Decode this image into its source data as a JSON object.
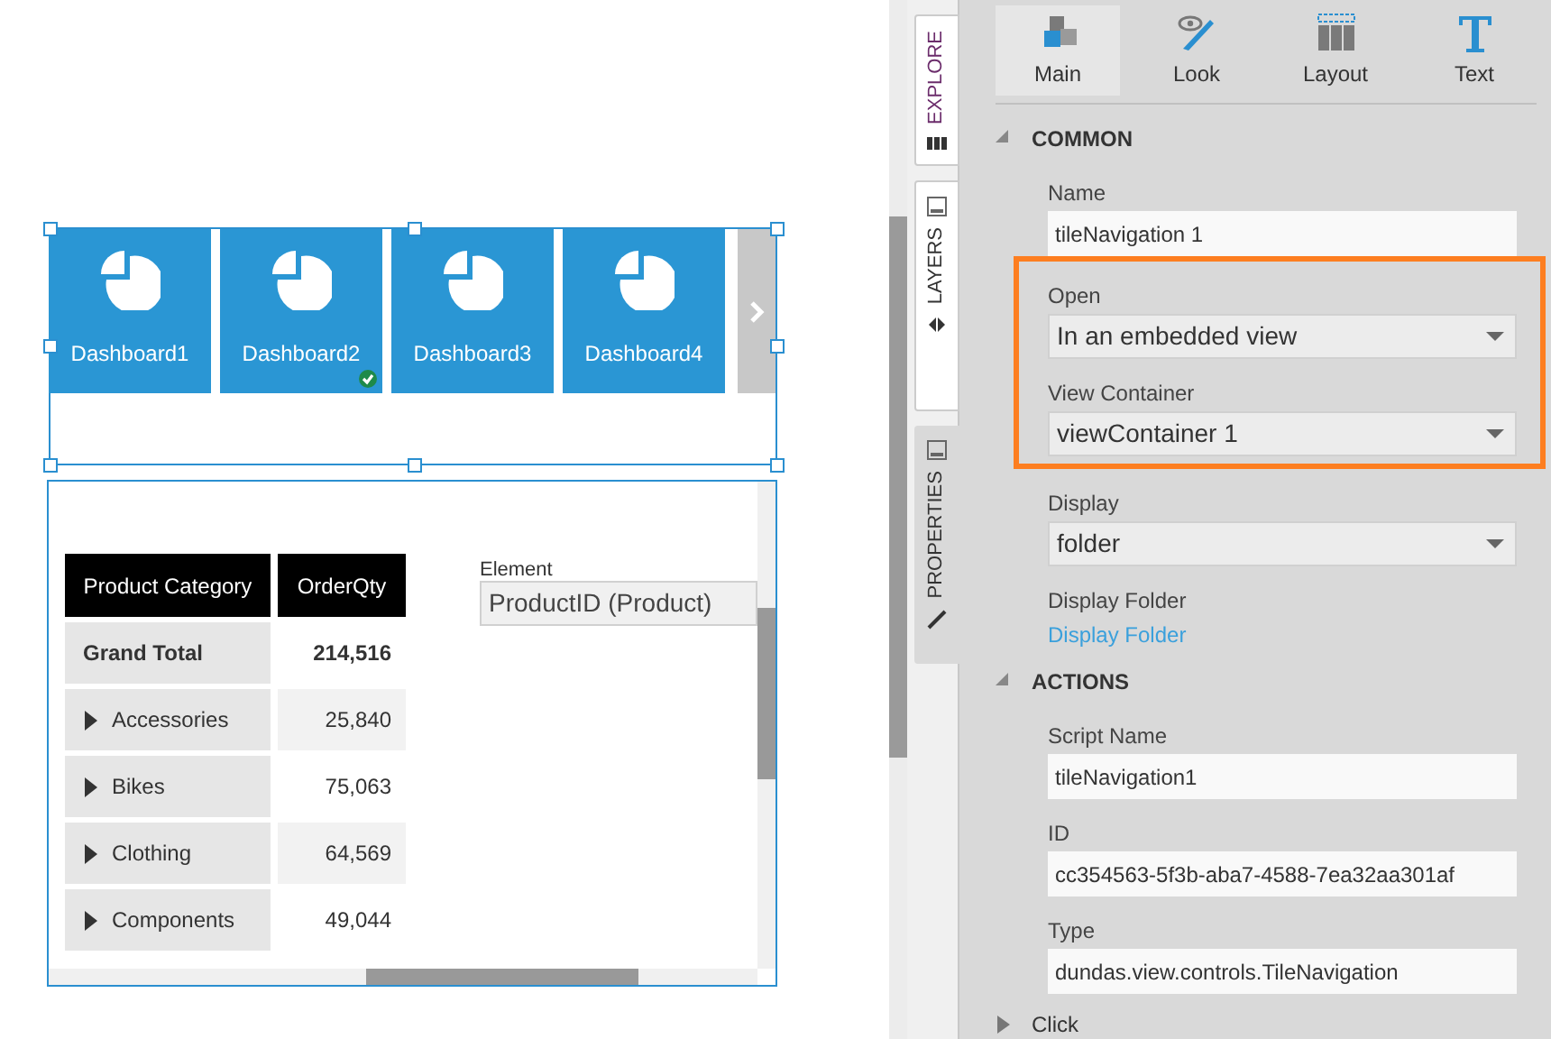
{
  "tile_navigation": {
    "tiles": [
      {
        "label": "Dashboard1",
        "selected": false
      },
      {
        "label": "Dashboard2",
        "selected": true
      },
      {
        "label": "Dashboard3",
        "selected": false
      },
      {
        "label": "Dashboard4",
        "selected": false
      }
    ]
  },
  "table": {
    "columns": [
      "Product Category",
      "OrderQty"
    ],
    "rows": [
      {
        "kind": "total",
        "category": "Grand Total",
        "value": "214,516"
      },
      {
        "kind": "group",
        "category": "Accessories",
        "value": "25,840",
        "expanded": false
      },
      {
        "kind": "group",
        "category": "Bikes",
        "value": "75,063",
        "expanded": false
      },
      {
        "kind": "group",
        "category": "Clothing",
        "value": "64,569",
        "expanded": false
      },
      {
        "kind": "group",
        "category": "Components",
        "value": "49,044",
        "expanded": false
      }
    ]
  },
  "element_filter": {
    "label": "Element",
    "value": "ProductID (Product)"
  },
  "side_tabs": [
    {
      "label": "EXPLORE",
      "selected": false
    },
    {
      "label": "LAYERS",
      "selected": false
    },
    {
      "label": "PROPERTIES",
      "selected": true
    }
  ],
  "toolbar": [
    {
      "kind": "main",
      "label": "Main",
      "selected": true
    },
    {
      "kind": "look",
      "label": "Look",
      "selected": false
    },
    {
      "kind": "layout",
      "label": "Layout",
      "selected": false
    },
    {
      "kind": "text",
      "label": "Text",
      "selected": false
    }
  ],
  "sections": [
    {
      "title": "COMMON",
      "expanded": true,
      "items": [
        {
          "label": "Name",
          "kind": "text",
          "value": "tileNavigation 1",
          "highlighted": false
        },
        {
          "label": "Open",
          "kind": "select",
          "value": "In an embedded view",
          "highlighted": true
        },
        {
          "label": "View Container",
          "kind": "select",
          "value": "viewContainer 1",
          "highlighted": true
        },
        {
          "label": "Display",
          "kind": "select",
          "value": "folder",
          "highlighted": false
        },
        {
          "label": "Display Folder",
          "kind": "link",
          "value": "Display Folder",
          "highlighted": false
        }
      ]
    },
    {
      "title": "ACTIONS",
      "expanded": true,
      "items": [
        {
          "label": "Script Name",
          "kind": "text",
          "value": "tileNavigation1",
          "highlighted": false
        },
        {
          "label": "ID",
          "kind": "text",
          "value": "cc354563-5f3b-aba7-4588-7ea32aa301af",
          "highlighted": false
        },
        {
          "label": "Type",
          "kind": "text",
          "value": "dundas.view.controls.TileNavigation",
          "highlighted": false
        }
      ]
    },
    {
      "title": "Click",
      "expanded": false
    }
  ]
}
